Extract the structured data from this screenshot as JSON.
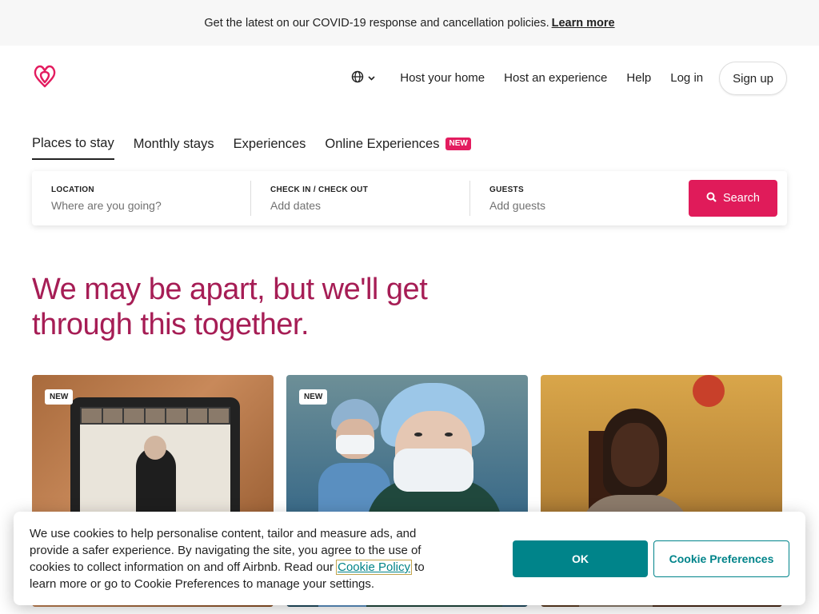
{
  "banner": {
    "text": "Get the latest on our COVID-19 response and cancellation policies.",
    "link": "Learn more"
  },
  "header": {
    "logo_icon": "airbnb-logo-icon",
    "globe_icon": "globe-icon",
    "chevron_icon": "chevron-down-icon",
    "links": [
      "Host your home",
      "Host an experience",
      "Help",
      "Log in"
    ],
    "signup": "Sign up"
  },
  "tabs": [
    {
      "label": "Places to stay",
      "active": true
    },
    {
      "label": "Monthly stays",
      "active": false
    },
    {
      "label": "Experiences",
      "active": false
    },
    {
      "label": "Online Experiences",
      "active": false,
      "badge": "NEW"
    }
  ],
  "search": {
    "location": {
      "label": "LOCATION",
      "placeholder": "Where are you going?"
    },
    "dates": {
      "label": "CHECK IN / CHECK OUT",
      "placeholder": "Add dates"
    },
    "guests": {
      "label": "GUESTS",
      "placeholder": "Add guests"
    },
    "button": "Search",
    "button_icon": "search-icon",
    "accent_color": "#e01b5a"
  },
  "headline": "We may be apart, but we'll get through this together.",
  "cards": [
    {
      "badge": "NEW",
      "image": "online-experience-tablet-cooking"
    },
    {
      "badge": "NEW",
      "image": "healthcare-workers-masks"
    },
    {
      "badge": "",
      "image": "host-woman-portrait"
    }
  ],
  "cookie": {
    "text_before": "We use cookies to help personalise content, tailor and measure ads, and provide a safer experience. By navigating the site, you agree to the use of cookies to collect information on and off Airbnb. Read our",
    "link": "Cookie Policy",
    "text_after": "to learn more or go to Cookie Preferences to manage your settings.",
    "ok": "OK",
    "preferences": "Cookie Preferences",
    "accent_color": "#00848a"
  }
}
